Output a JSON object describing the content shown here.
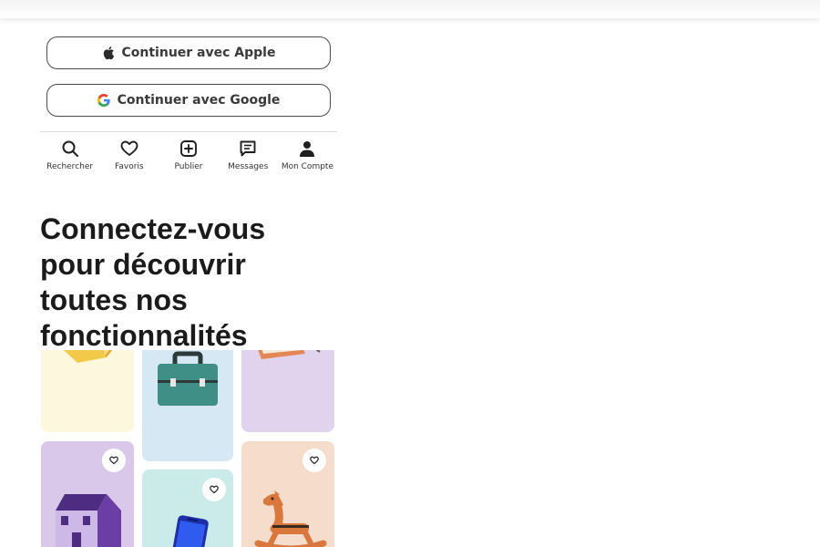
{
  "auth": {
    "apple_label": "Continuer avec Apple",
    "google_label": "Continuer avec Google"
  },
  "tabs": [
    {
      "label": "Rechercher",
      "icon": "search-icon"
    },
    {
      "label": "Favoris",
      "icon": "heart-icon"
    },
    {
      "label": "Publier",
      "icon": "plus-square-icon"
    },
    {
      "label": "Messages",
      "icon": "message-icon"
    },
    {
      "label": "Mon Compte",
      "icon": "user-icon"
    }
  ],
  "hero": {
    "title": "Connectez-vous pour découvrir toutes nos fonctionnalités"
  },
  "illustrations": [
    {
      "name": "box-illustration",
      "color": "#fdf7dd"
    },
    {
      "name": "briefcase-illustration",
      "color": "#d5e8f4"
    },
    {
      "name": "books-illustration",
      "color": "#e1d3ee"
    },
    {
      "name": "house-illustration",
      "color": "#d9c8ea"
    },
    {
      "name": "phone-illustration",
      "color": "#cbeaea"
    },
    {
      "name": "rocking-horse-illustration",
      "color": "#f5dccb"
    }
  ],
  "colors": {
    "text": "#1b1b1b",
    "button_border": "#4a4a4a"
  }
}
